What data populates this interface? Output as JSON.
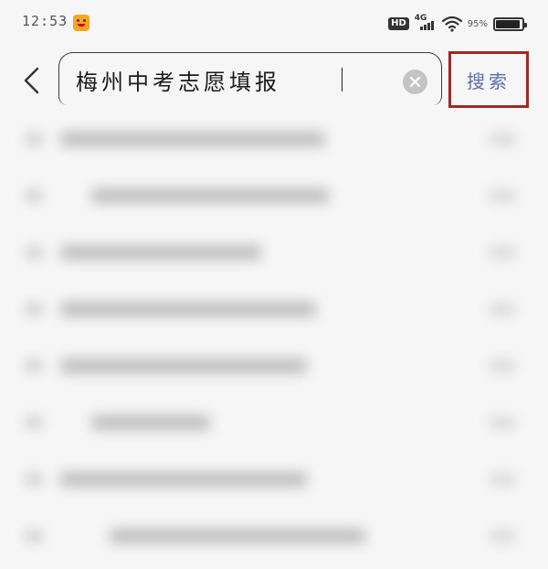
{
  "status_bar": {
    "time": "12:53",
    "network": "4G",
    "hd": "HD",
    "battery_text": "95%"
  },
  "search": {
    "query": "梅州中考志愿填报",
    "submit_label": "搜索",
    "back_icon": "chevron-left-icon",
    "clear_icon": "close-circle-icon"
  },
  "colors": {
    "search_button_text": "#5b6fa8",
    "highlight_frame": "#a12828",
    "background": "#f6f6f6"
  }
}
